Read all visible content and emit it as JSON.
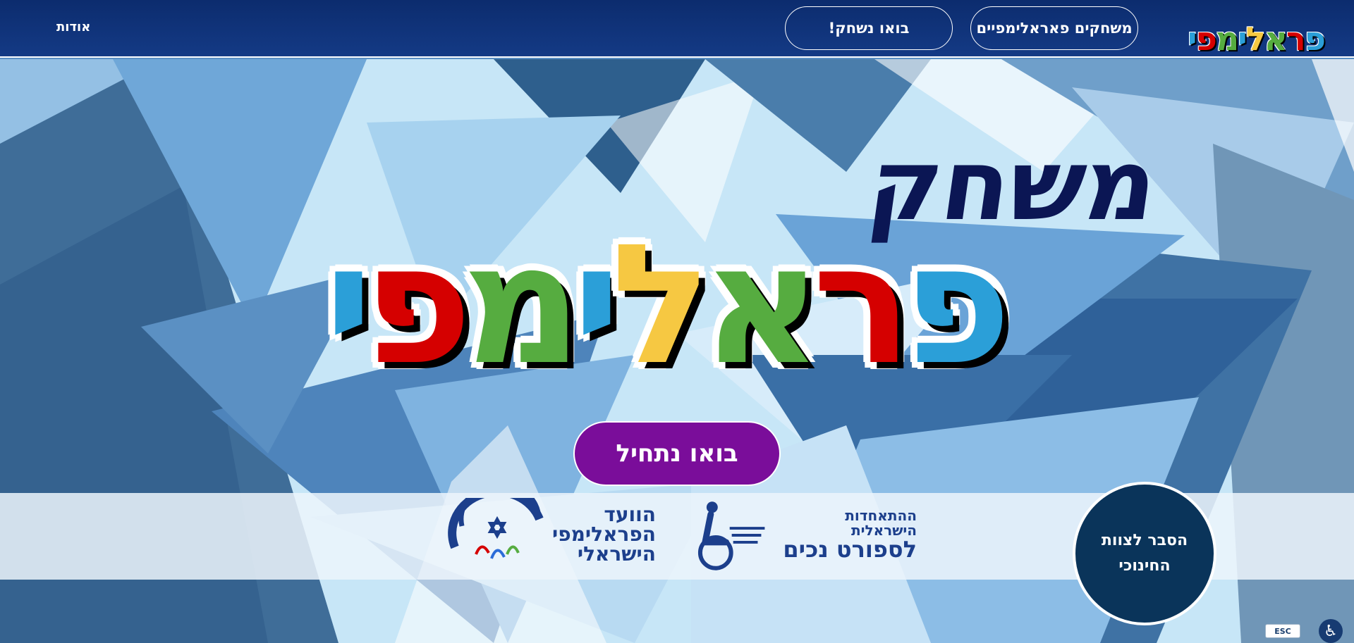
{
  "header": {
    "logo_letters": [
      {
        "char": "פ",
        "color": "#2b9fd8"
      },
      {
        "char": "ר",
        "color": "#d50000"
      },
      {
        "char": "א",
        "color": "#56ac40"
      },
      {
        "char": "ל",
        "color": "#f6c842"
      },
      {
        "char": "י",
        "color": "#2b9fd8"
      },
      {
        "char": "מ",
        "color": "#56ac40"
      },
      {
        "char": "פ",
        "color": "#d50000"
      },
      {
        "char": "י",
        "color": "#2b9fd8"
      }
    ],
    "nav_games_label": "משחקים פאראלימפיים",
    "nav_play_label": "בואו נשחק!",
    "nav_about_label": "אודות"
  },
  "hero": {
    "subtitle": "משחק",
    "logo_letters": [
      {
        "char": "פ",
        "color": "#2b9fd8"
      },
      {
        "char": "ר",
        "color": "#d50000"
      },
      {
        "char": "א",
        "color": "#56ac40"
      },
      {
        "char": "ל",
        "color": "#f6c842"
      },
      {
        "char": "י",
        "color": "#2b9fd8"
      },
      {
        "char": "מ",
        "color": "#56ac40"
      },
      {
        "char": "פ",
        "color": "#d50000"
      },
      {
        "char": "י",
        "color": "#2b9fd8"
      }
    ],
    "start_button_label": "בואו נתחיל"
  },
  "footer": {
    "partner1_line1": "ההתאחדות הישראלית",
    "partner1_line2": "לספורט נכים",
    "partner2_line1": "הוועד",
    "partner2_line2": "הפראלימפי",
    "partner2_line3": "הישראלי",
    "education_line1": "הסבר לצוות",
    "education_line2": "החינוכי"
  },
  "controls": {
    "esc_label": "ESC"
  },
  "colors": {
    "header_bg": "#0c2c6e",
    "start_button": "#7a0d9a",
    "title_dark": "#0b1654",
    "circle_bg": "#0a345a"
  }
}
